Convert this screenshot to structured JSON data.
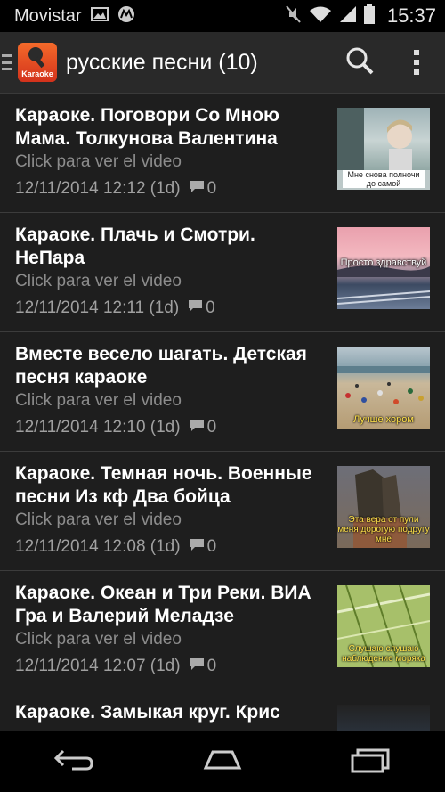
{
  "status_bar": {
    "carrier": "Movistar",
    "time": "15:37",
    "icons": [
      "image-icon",
      "motorola-icon",
      "mute-icon",
      "wifi-icon",
      "signal-icon",
      "battery-icon"
    ]
  },
  "action_bar": {
    "logo_text": "Karaoke",
    "title": "русские песни (10)",
    "icons": [
      "search-icon",
      "overflow-menu-icon"
    ]
  },
  "list": {
    "items": [
      {
        "title": "Караоке. Поговори Со Мною Мама. Толкунова Валентина",
        "subtitle": "Click para ver el video",
        "date": "12/11/2014 12:12 (1d)",
        "comments": "0",
        "thumb_caption": "Мне снова полночи до самой"
      },
      {
        "title": "Караоке. Плачь и Смотри. НеПара",
        "subtitle": "Click para ver el video",
        "date": "12/11/2014 12:11 (1d)",
        "comments": "0",
        "thumb_caption": "Просто здравствуй"
      },
      {
        "title": "Вместе весело шагать. Детская песня караоке",
        "subtitle": "Click para ver el video",
        "date": "12/11/2014 12:10 (1d)",
        "comments": "0",
        "thumb_caption": "Лучше хором"
      },
      {
        "title": "Караоке. Темная ночь. Военные песни Из кф Два бойца",
        "subtitle": "Click para ver el video",
        "date": "12/11/2014 12:08 (1d)",
        "comments": "0",
        "thumb_caption": "Эта вера от пули меня дорогую подругу мне"
      },
      {
        "title": "Караоке. Океан и Три Реки. ВИА Гра и Валерий Меладзе",
        "subtitle": "Click para ver el video",
        "date": "12/11/2014 12:07 (1d)",
        "comments": "0",
        "thumb_caption": "Слушаю слушаю наблюдение моряка"
      },
      {
        "title": "Караоке. Замыкая круг. Крис",
        "subtitle": "",
        "date": "",
        "comments": "",
        "thumb_caption": ""
      }
    ]
  },
  "nav_bar": {
    "icons": [
      "back-icon",
      "home-icon",
      "recent-apps-icon"
    ]
  }
}
